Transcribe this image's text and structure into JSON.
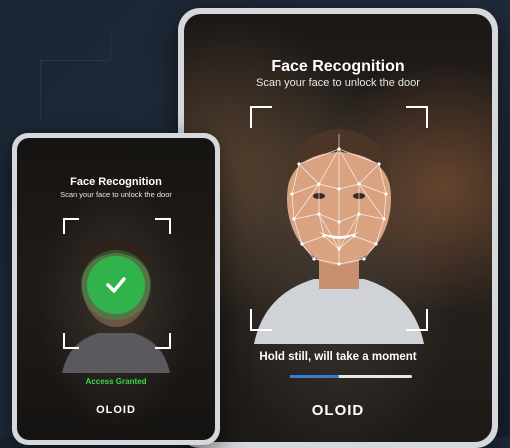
{
  "large_tablet": {
    "title": "Face Recognition",
    "subtitle": "Scan your face to unlock the door",
    "status_text": "Hold still, will take a moment",
    "progress": 0.4,
    "brand": "OLOID"
  },
  "small_tablet": {
    "title": "Face Recognition",
    "subtitle": "Scan your face to unlock the door",
    "access_text": "Access Granted",
    "brand": "OLOID"
  },
  "colors": {
    "success": "#2fb34a",
    "progress": "#3a7bd5"
  },
  "icons": [
    "face-mesh-icon",
    "checkmark-icon"
  ]
}
